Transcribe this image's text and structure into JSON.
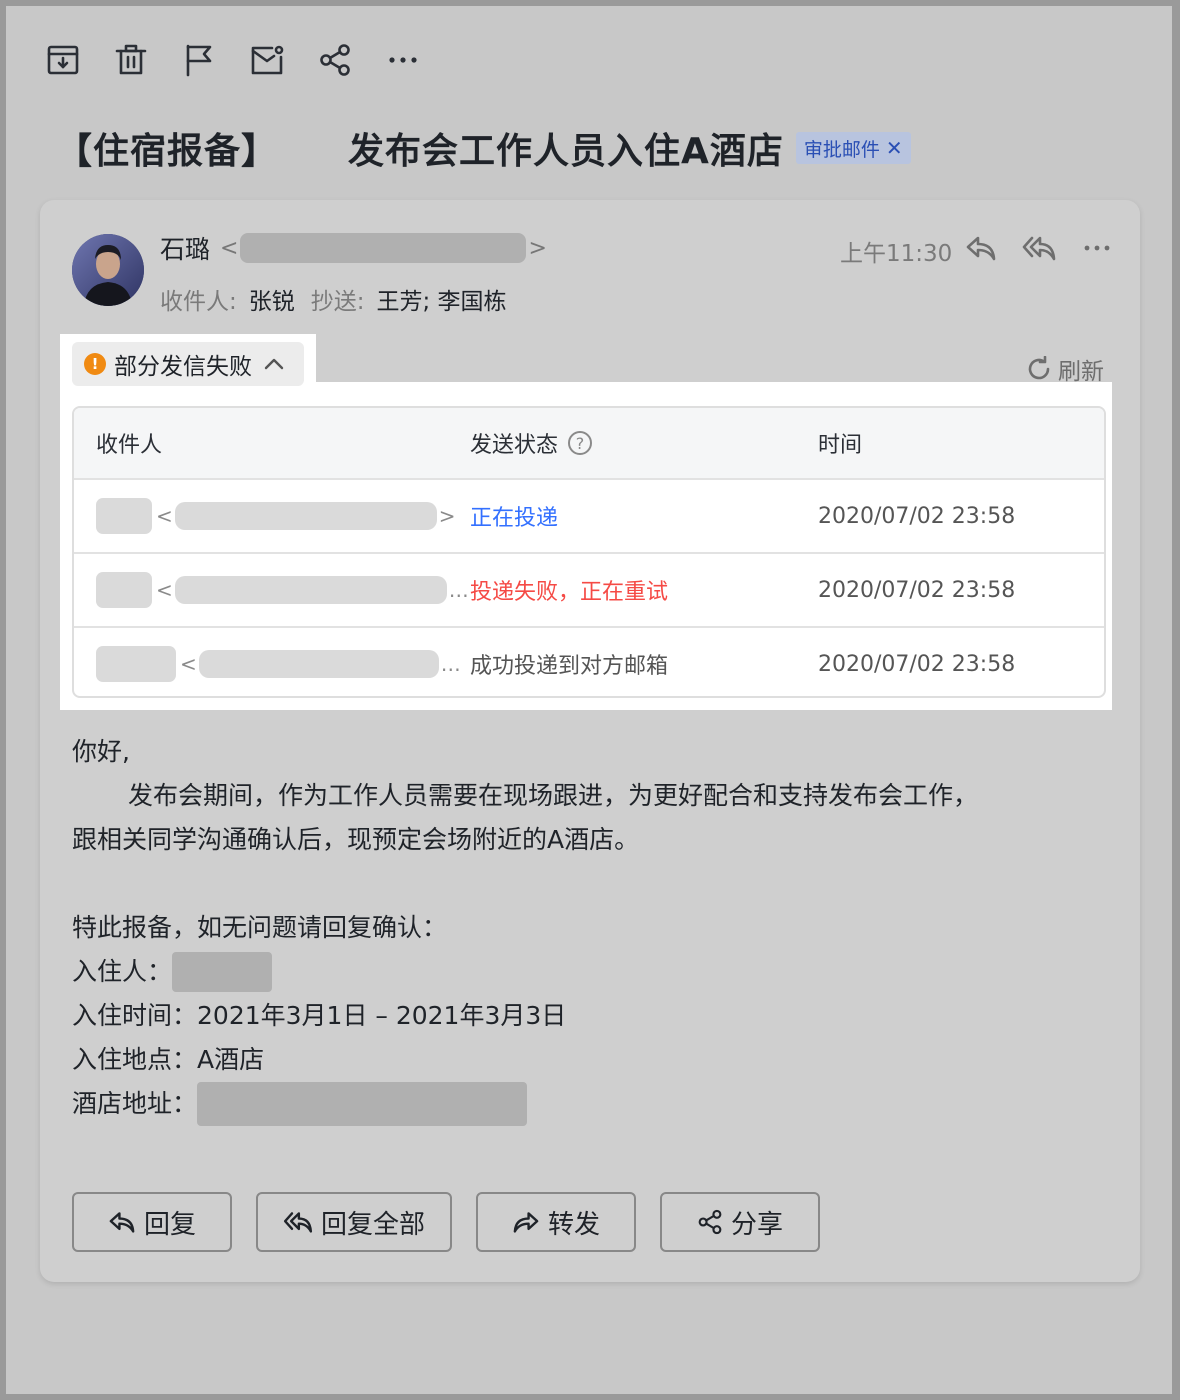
{
  "toolbar": {
    "items": [
      {
        "name": "archive-icon",
        "label": "归档"
      },
      {
        "name": "trash-icon",
        "label": "删除"
      },
      {
        "name": "flag-icon",
        "label": "标记"
      },
      {
        "name": "mark-unread-icon",
        "label": "未读"
      },
      {
        "name": "share-icon",
        "label": "分享"
      },
      {
        "name": "more-icon",
        "label": "更多"
      }
    ]
  },
  "subject": {
    "prefix": "【住宿报备】",
    "title": "发布会工作人员入住A酒店",
    "tag": "审批邮件"
  },
  "header": {
    "sender_name": "石璐",
    "to_label": "收件人:",
    "to_value": "张锐",
    "cc_label": "抄送:",
    "cc_value": "王芳;  李国栋",
    "time": "上午11:30"
  },
  "delivery": {
    "toggle_label": "部分发信失败",
    "refresh_label": "刷新",
    "columns": [
      "收件人",
      "发送状态",
      "时间"
    ],
    "rows": [
      {
        "status": "正在投递",
        "status_color": "#3370ff",
        "time": "2020/07/02 23:58"
      },
      {
        "status": "投递失败，正在重试",
        "status_color": "#f54a45",
        "time": "2020/07/02 23:58"
      },
      {
        "status": "成功投递到对方邮箱",
        "status_color": "#555555",
        "time": "2020/07/02 23:58"
      }
    ]
  },
  "body": {
    "greeting": "你好,",
    "para1": "发布会期间，作为工作人员需要在现场跟进，为更好配合和支持发布会工作，",
    "para2": "跟相关同学沟通确认后，现预定会场附近的A酒店。",
    "notice": "特此报备，如无问题请回复确认：",
    "guest_label": "入住人：",
    "date_label": "入住时间：",
    "date_value": "2021年3月1日 – 2021年3月3日",
    "place_label": "入住地点：",
    "place_value": "A酒店",
    "address_label": "酒店地址："
  },
  "footer": {
    "reply": "回复",
    "reply_all": "回复全部",
    "forward": "转发",
    "share": "分享"
  }
}
